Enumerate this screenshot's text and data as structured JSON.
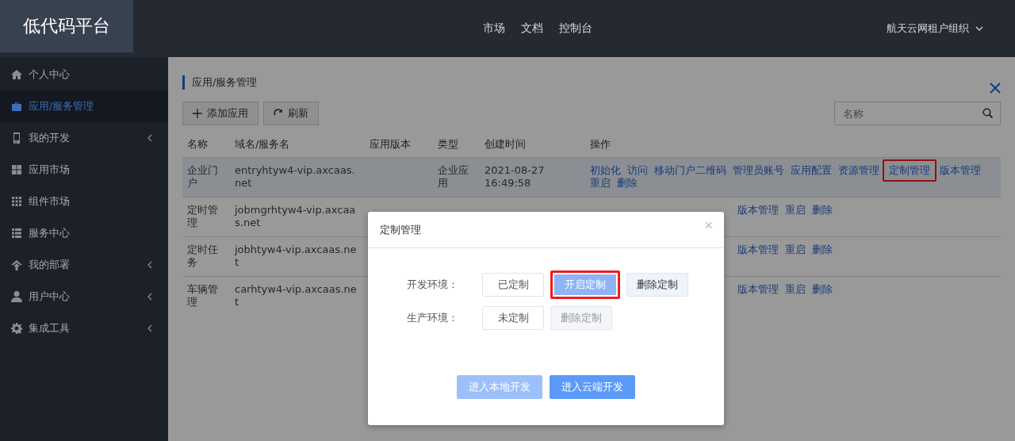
{
  "header": {
    "logo": "低代码平台",
    "nav": [
      {
        "label": "市场"
      },
      {
        "label": "文档"
      },
      {
        "label": "控制台"
      }
    ],
    "org": "航天云网租户组织"
  },
  "sidebar": {
    "items": [
      {
        "label": "个人中心",
        "selected": false,
        "expandable": false
      },
      {
        "label": "应用/服务管理",
        "selected": true,
        "expandable": false
      },
      {
        "label": "我的开发",
        "selected": false,
        "expandable": true
      },
      {
        "label": "应用市场",
        "selected": false,
        "expandable": false
      },
      {
        "label": "组件市场",
        "selected": false,
        "expandable": false
      },
      {
        "label": "服务中心",
        "selected": false,
        "expandable": false
      },
      {
        "label": "我的部署",
        "selected": false,
        "expandable": true
      },
      {
        "label": "用户中心",
        "selected": false,
        "expandable": true
      },
      {
        "label": "集成工具",
        "selected": false,
        "expandable": true
      }
    ]
  },
  "page": {
    "breadcrumb": "应用/服务管理",
    "toolbar": [
      {
        "label": "添加应用"
      },
      {
        "label": "刷新"
      }
    ],
    "search": {
      "placeholder": "名称"
    }
  },
  "table": {
    "columns": [
      "名称",
      "域名/服务名",
      "应用版本",
      "类型",
      "创建时间",
      "操作"
    ],
    "rows": [
      {
        "selected": true,
        "name": "企业门户",
        "domain": "entryhtyw4-vip.axcaas.net",
        "type": "企业应用",
        "created": "2021-08-27 16:49:58",
        "actions": [
          {
            "label": "初始化",
            "highlighted": false
          },
          {
            "label": "访问",
            "highlighted": false
          },
          {
            "label": "移动门户二维码",
            "highlighted": false
          },
          {
            "label": "管理员账号",
            "highlighted": false
          },
          {
            "label": "应用配置",
            "highlighted": false
          },
          {
            "label": "资源管理",
            "highlighted": false
          },
          {
            "label": "定制管理",
            "highlighted": true
          },
          {
            "label": "版本管理",
            "highlighted": false
          },
          {
            "label": "重启",
            "highlighted": false
          },
          {
            "label": "删除",
            "highlighted": false
          }
        ]
      },
      {
        "selected": false,
        "name": "定时管理",
        "domain": "jobmgrhtyw4-vip.axcaas.net",
        "actions": [
          {
            "label": "版本管理",
            "highlighted": false
          },
          {
            "label": "重启",
            "highlighted": false
          },
          {
            "label": "删除",
            "highlighted": false
          }
        ]
      },
      {
        "selected": false,
        "name": "定时任务",
        "domain": "jobhtyw4-vip.axcaas.net",
        "actions": [
          {
            "label": "版本管理",
            "highlighted": false
          },
          {
            "label": "重启",
            "highlighted": false
          },
          {
            "label": "删除",
            "highlighted": false
          }
        ]
      },
      {
        "selected": false,
        "name": "车辆管理",
        "domain": "carhtyw4-vip.axcaas.net",
        "actions": [
          {
            "label": "版本管理",
            "highlighted": false
          },
          {
            "label": "重启",
            "highlighted": false
          },
          {
            "label": "删除",
            "highlighted": false
          }
        ]
      }
    ]
  },
  "dialog": {
    "title": "定制管理",
    "close": "×",
    "environments": [
      {
        "label": "开发环境：",
        "status": "已定制",
        "buttons": [
          {
            "label": "开启定制",
            "kind": "primary",
            "disabled": false,
            "highlighted": true
          },
          {
            "label": "删除定制",
            "kind": "plain",
            "disabled": false,
            "highlighted": false
          }
        ]
      },
      {
        "label": "生产环境：",
        "status": "未定制",
        "buttons": [
          {
            "label": "删除定制",
            "kind": "plain",
            "disabled": true,
            "highlighted": false
          }
        ]
      }
    ],
    "footer": [
      {
        "label": "进入本地开发",
        "disabled": true
      },
      {
        "label": "进入云端开发",
        "disabled": false
      }
    ]
  }
}
